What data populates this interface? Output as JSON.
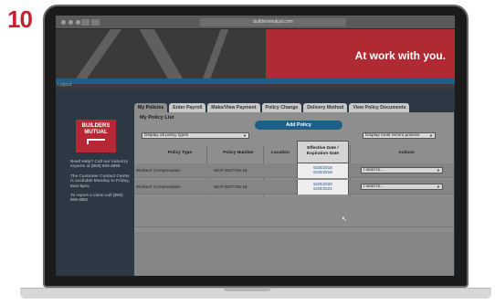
{
  "step": "10",
  "browser": {
    "url": "buildersmutual.com"
  },
  "hero": {
    "slogan": "At work with you."
  },
  "user": {
    "link": "Logout"
  },
  "brand": {
    "line1": "BUILDERS",
    "line2": "MUTUAL"
  },
  "sidebar": {
    "help": "Need Help? Call our industry experts at (800) 809-4859",
    "center": "The Customer Contact Center is available Monday to Friday, 8am-8pm.",
    "claim": "To report a claim call (800) 809-4862"
  },
  "tabs": [
    "My Policies",
    "Enter Payroll",
    "Make/View Payment",
    "Policy Change",
    "Delivery Method",
    "View Policy Documents"
  ],
  "policy_list": {
    "title": "My Policy List",
    "add_button": "Add Policy",
    "type_filter": "Display all policy types",
    "recent_filter": "Display most recent policies"
  },
  "table": {
    "headers": {
      "type": "Policy Type",
      "number": "Policy Number",
      "location": "Location",
      "dates": "Effective Date / Expiration Date",
      "actions": "Actions"
    },
    "rows": [
      {
        "type": "Workers' Compensation",
        "number": "WCP 0027726-16",
        "effective": "5/20/2018",
        "expiration": "5/20/2019",
        "action": "I want to..."
      },
      {
        "type": "Workers' Compensation",
        "number": "WCP 0027726-16",
        "effective": "5/20/2020",
        "expiration": "5/20/2021",
        "action": "I want to..."
      }
    ]
  },
  "colors": {
    "brand_red": "#b82733",
    "brand_blue": "#1f5f86",
    "accent": "#c8202f"
  }
}
